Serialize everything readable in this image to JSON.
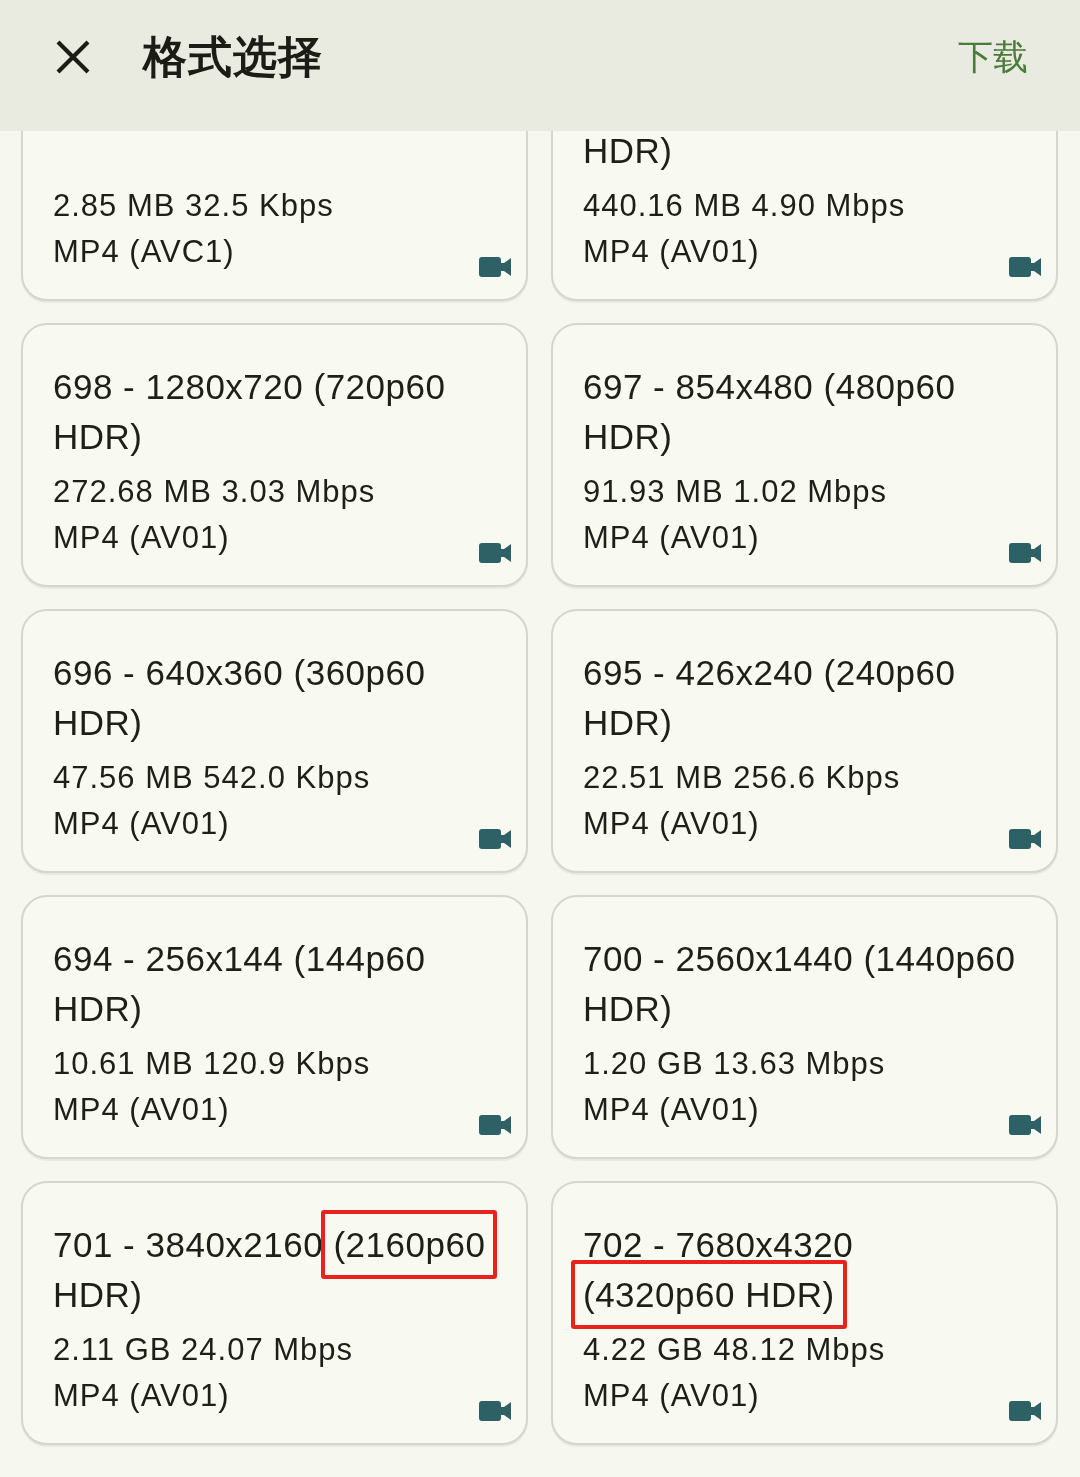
{
  "header": {
    "title": "格式选择",
    "action": "下载"
  },
  "rows": [
    {
      "cards": [
        {
          "details": "2.85 MB 32.5 Kbps",
          "codec": "MP4 (AVC1)"
        },
        {
          "title": [
            {
              "text": "HDR)",
              "highlighted": false
            }
          ],
          "details": "440.16 MB 4.90 Mbps",
          "codec": "MP4 (AV01)"
        }
      ]
    },
    {
      "cards": [
        {
          "title": [
            {
              "text": "698 - 1280x720 (720p60 HDR)",
              "highlighted": false
            }
          ],
          "details": "272.68 MB 3.03 Mbps",
          "codec": "MP4 (AV01)"
        },
        {
          "title": [
            {
              "text": "697 - 854x480 (480p60 HDR)",
              "highlighted": false
            }
          ],
          "details": "91.93 MB 1.02 Mbps",
          "codec": "MP4 (AV01)"
        }
      ]
    },
    {
      "cards": [
        {
          "title": [
            {
              "text": "696 - 640x360 (360p60 HDR)",
              "highlighted": false
            }
          ],
          "details": "47.56 MB 542.0 Kbps",
          "codec": "MP4 (AV01)"
        },
        {
          "title": [
            {
              "text": "695 - 426x240 (240p60 HDR)",
              "highlighted": false
            }
          ],
          "details": "22.51 MB 256.6 Kbps",
          "codec": "MP4 (AV01)"
        }
      ]
    },
    {
      "cards": [
        {
          "title": [
            {
              "text": "694 - 256x144 (144p60 HDR)",
              "highlighted": false
            }
          ],
          "details": "10.61 MB 120.9 Kbps",
          "codec": "MP4 (AV01)"
        },
        {
          "title": [
            {
              "text": "700 - 2560x1440 (1440p60 HDR)",
              "highlighted": false
            }
          ],
          "details": "1.20 GB 13.63 Mbps",
          "codec": "MP4 (AV01)"
        }
      ]
    },
    {
      "cards": [
        {
          "title": [
            {
              "text": "701 - 3840x2160",
              "highlighted": false
            },
            {
              "text": "(2160p60",
              "highlighted": true
            },
            {
              "text": "HDR)",
              "highlighted": false
            }
          ],
          "details": "2.11 GB 24.07 Mbps",
          "codec": "MP4 (AV01)"
        },
        {
          "title": [
            {
              "text": "702 - 7680x4320",
              "highlighted": false
            },
            {
              "text": "(4320p60 HDR)",
              "highlighted": true
            }
          ],
          "details": "4.22 GB 48.12 Mbps",
          "codec": "MP4 (AV01)"
        }
      ]
    }
  ]
}
